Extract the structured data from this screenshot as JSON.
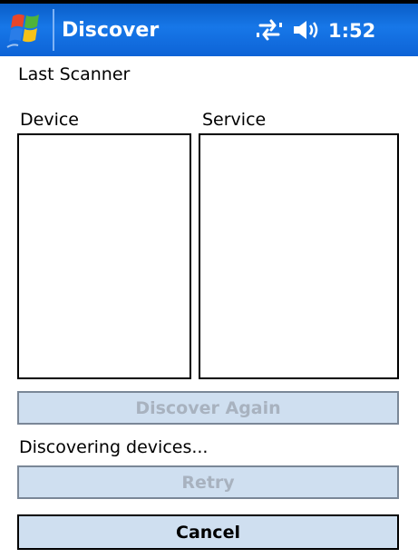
{
  "titlebar": {
    "title": "Discover",
    "time": "1:52",
    "bg_color": "#0d63d6",
    "icons": {
      "start": "windows-start-icon",
      "connectivity": "connectivity-icon",
      "volume": "volume-icon"
    }
  },
  "content": {
    "last_scanner_label": "Last Scanner",
    "device_header": "Device",
    "service_header": "Service",
    "device_items": [],
    "service_items": [],
    "status_text": "Discovering devices..."
  },
  "buttons": {
    "discover_again": "Discover Again",
    "retry": "Retry",
    "cancel": "Cancel",
    "button_bg": "#cfdff0",
    "disabled_text_color": "#a8b2bf"
  }
}
